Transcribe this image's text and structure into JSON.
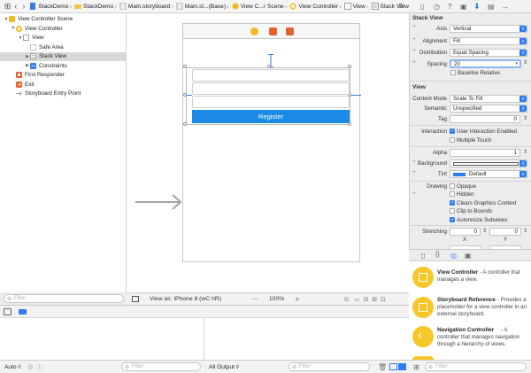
{
  "jumpbar": {
    "crumbs": [
      "StackDemo",
      "StackDemo",
      "Main.storyboard",
      "Main.st...(Base)",
      "View C...r Scene",
      "View Controller",
      "View",
      "Stack View"
    ]
  },
  "outline": {
    "rows": [
      {
        "label": "View Controller Scene",
        "indent": 0,
        "tri": "▼",
        "icon": "scene-icon",
        "color": "#f4b81e"
      },
      {
        "label": "View Controller",
        "indent": 1,
        "tri": "▼",
        "icon": "view-controller-icon",
        "color": "#f4b81e"
      },
      {
        "label": "View",
        "indent": 2,
        "tri": "▼",
        "icon": "view-icon",
        "color": "#ffffff"
      },
      {
        "label": "Safe Area",
        "indent": 3,
        "tri": "",
        "icon": "safe-area-icon",
        "color": "#ffffff"
      },
      {
        "label": "Stack View",
        "indent": 3,
        "tri": "▶",
        "icon": "stack-view-icon",
        "color": "#ffffff"
      },
      {
        "label": "Constraints",
        "indent": 3,
        "tri": "▶",
        "icon": "constraints-icon",
        "color": "#3a7be0"
      },
      {
        "label": "First Responder",
        "indent": 1,
        "tri": "",
        "icon": "first-responder-icon",
        "color": "#e8602c"
      },
      {
        "label": "Exit",
        "indent": 1,
        "tri": "",
        "icon": "exit-icon",
        "color": "#e8602c"
      },
      {
        "label": "Storyboard Entry Point",
        "indent": 1,
        "tri": "",
        "icon": "entry-point-icon",
        "color": "#888888"
      }
    ],
    "selected_index": 4,
    "filter_placeholder": "Filter"
  },
  "canvas": {
    "register_label": "Register",
    "button_color": "#1a8ae6"
  },
  "canvasbar": {
    "view_as": "View as: iPhone 8 (wC hR)",
    "zoom": "100%",
    "minus": "—",
    "plus": "+"
  },
  "bottombar": {
    "auto": "Auto ◊",
    "filter_placeholder": "Filter",
    "all_output": "All Output ◊",
    "filter_placeholder2": "Filter"
  },
  "inspector": {
    "stack_title": "Stack View",
    "axis_label": "Axis",
    "axis_value": "Vertical",
    "alignment_label": "Alignment",
    "alignment_value": "Fill",
    "distribution_label": "Distribution",
    "distribution_value": "Equal Spacing",
    "spacing_label": "Spacing",
    "spacing_value": "20",
    "baseline_label": "Baseline Relative",
    "view_title": "View",
    "content_mode_label": "Content Mode",
    "content_mode_value": "Scale To Fill",
    "semantic_label": "Semantic",
    "semantic_value": "Unspecified",
    "tag_label": "Tag",
    "tag_value": "0",
    "interaction_label": "Interaction",
    "user_interaction_label": "User Interaction Enabled",
    "multiple_touch_label": "Multiple Touch",
    "alpha_label": "Alpha",
    "alpha_value": "1",
    "background_label": "Background",
    "tint_label": "Tint",
    "tint_value": "Default",
    "drawing_label": "Drawing",
    "opaque_label": "Opaque",
    "hidden_label": "Hidden",
    "clears_label": "Clears Graphics Context",
    "clip_label": "Clip to Bounds",
    "autoresize_label": "Autoresize Subviews",
    "stretching_label": "Stretching",
    "stretch_x_value": "0",
    "stretch_y_value": "0",
    "x_label": "X",
    "y_label": "Y",
    "accent_color": "#2f7cf6"
  },
  "library": {
    "items": [
      {
        "title": "View Controller",
        "desc": " - A controller that manages a view."
      },
      {
        "title": "Storyboard Reference",
        "desc": " - Provides a placeholder for a view controller in an external storyboard."
      },
      {
        "title": "Navigation Controller",
        "desc": " - A controller that manages navigation through a hierarchy of views."
      }
    ],
    "filter_placeholder": "Filter"
  }
}
